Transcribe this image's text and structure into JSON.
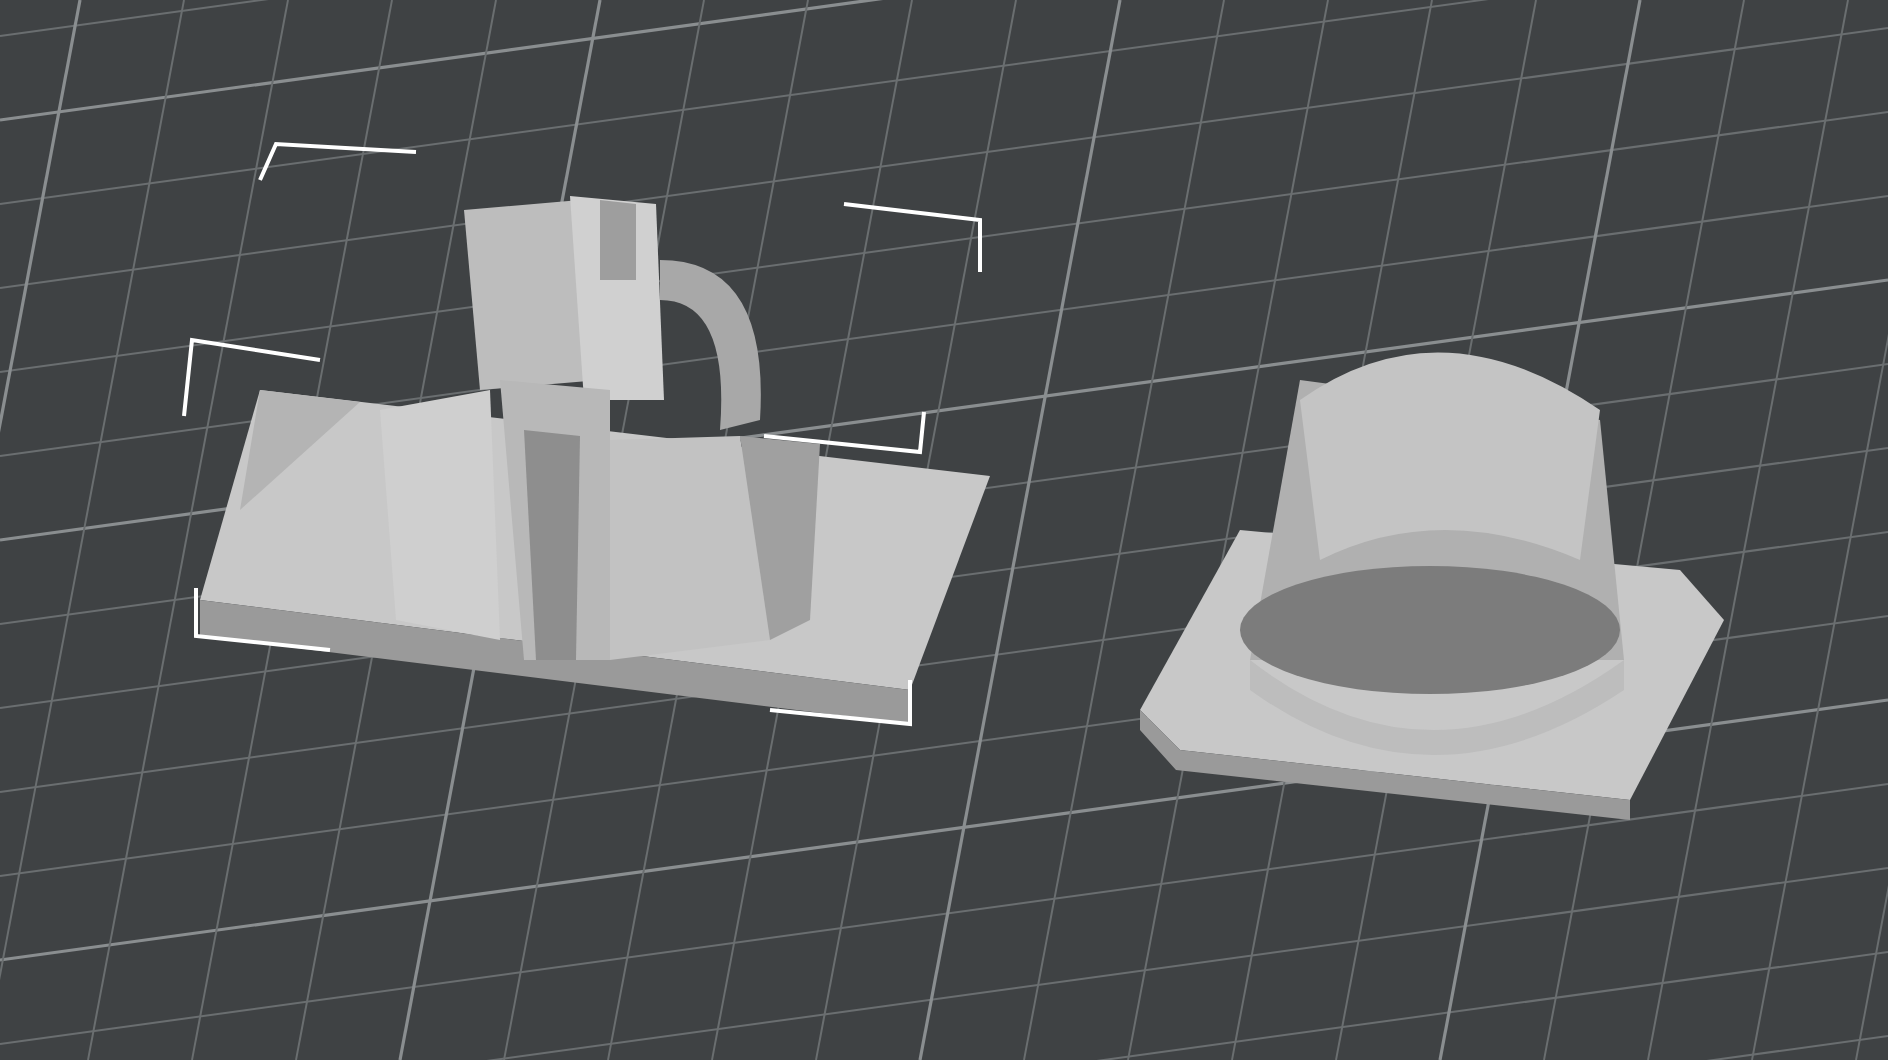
{
  "viewport": {
    "objects": [
      {
        "kind": "clip",
        "selected": true
      },
      {
        "kind": "collar",
        "selected": false
      }
    ]
  }
}
